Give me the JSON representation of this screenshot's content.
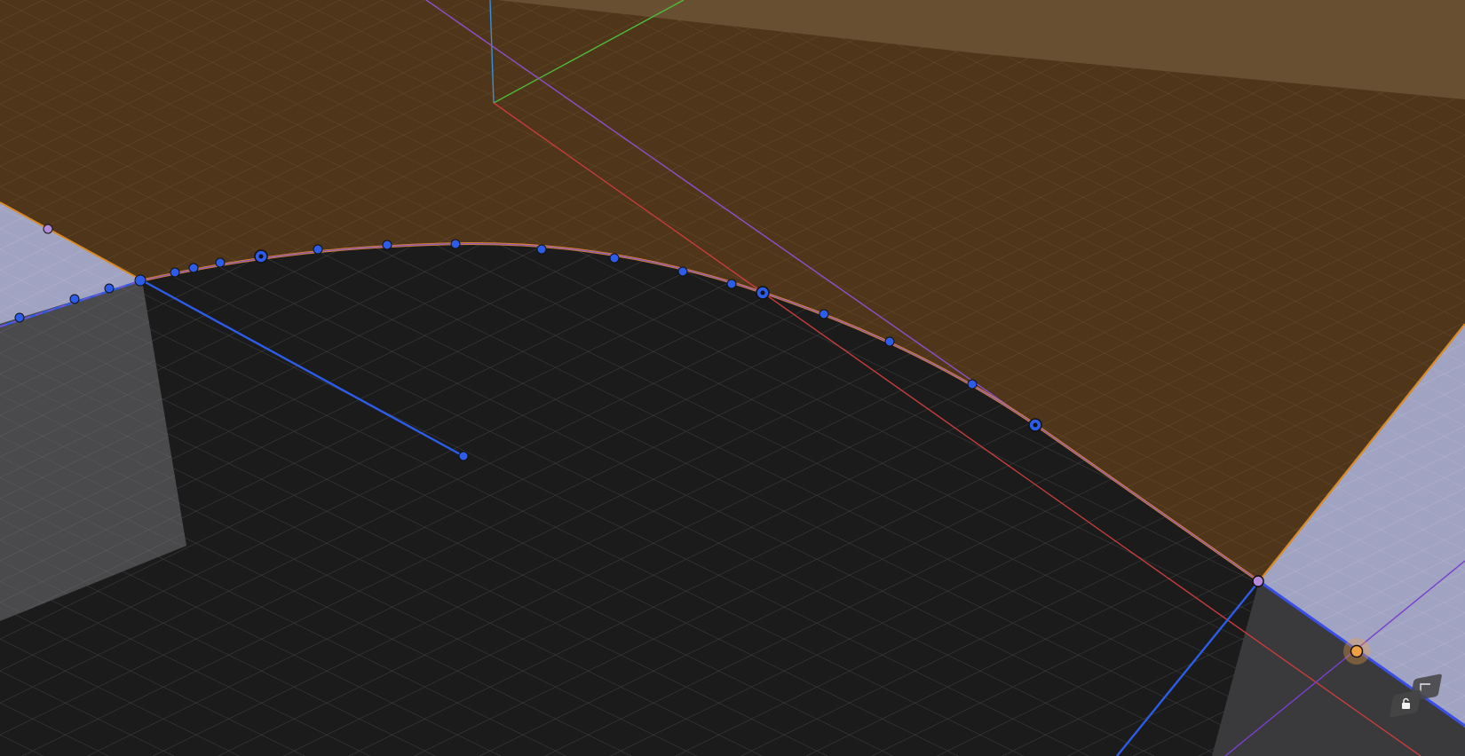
{
  "viewport": {
    "mode": "3d-sketch-edit",
    "background_color": "#1b1b1b"
  },
  "colors": {
    "sketch_plane": "#4f3519",
    "sketch_plane_light": "#6c5234",
    "face_light": "#a1a3c2",
    "face_gray": "#4a4a4c",
    "dark_floor": "#1b1b1b",
    "curve_orange": "#d98a25",
    "curve_purple": "#8a4fc4",
    "handle_blue": "#2c5ce8",
    "axis_red": "#c73c3c",
    "axis_green": "#4dbb3a",
    "axis_blue": "#3a8fd6",
    "active_point": "#f0a040"
  },
  "icons": {
    "constraint_corner": "corner-constraint-icon",
    "constraint_lock": "lock-constraint-icon"
  }
}
